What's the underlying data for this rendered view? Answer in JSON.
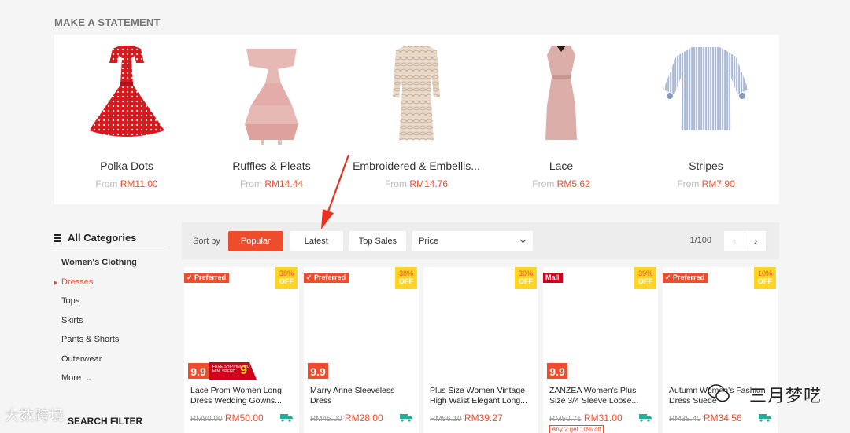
{
  "section_title": "MAKE A STATEMENT",
  "statement_categories": [
    {
      "name": "Polka Dots",
      "from_label": "From",
      "price": "RM11.00",
      "icon": "polka-dot-dress-image"
    },
    {
      "name": "Ruffles & Pleats",
      "from_label": "From",
      "price": "RM14.44",
      "icon": "ruffle-dress-image"
    },
    {
      "name": "Embroidered & Embellis...",
      "from_label": "From",
      "price": "RM14.76",
      "icon": "embroidered-dress-image"
    },
    {
      "name": "Lace",
      "from_label": "From",
      "price": "RM5.62",
      "icon": "lace-dress-image"
    },
    {
      "name": "Stripes",
      "from_label": "From",
      "price": "RM7.90",
      "icon": "striped-top-image"
    }
  ],
  "sidebar": {
    "heading": "All Categories",
    "items": [
      {
        "label": "Women's Clothing"
      },
      {
        "label": "Dresses"
      },
      {
        "label": "Tops"
      },
      {
        "label": "Skirts"
      },
      {
        "label": "Pants & Shorts"
      },
      {
        "label": "Outerwear"
      },
      {
        "label": "More"
      }
    ],
    "search_filter": "SEARCH FILTER"
  },
  "sortbar": {
    "label": "Sort by",
    "options": [
      {
        "label": "Popular"
      },
      {
        "label": "Latest"
      },
      {
        "label": "Top Sales"
      }
    ],
    "price_select": "Price",
    "page_info": "1/100"
  },
  "products": [
    {
      "tag": "Preferred",
      "discount": "38%",
      "off": "OFF",
      "badge": "9.9",
      "ship_banner": "FREE SHIPPING NO MIN. SPEND",
      "ship_num": "9",
      "name": "Lace Prom Women Long Dress Wedding Gowns...",
      "old_price": "RM80.00",
      "price": "RM50.00"
    },
    {
      "tag": "Preferred",
      "discount": "38%",
      "off": "OFF",
      "badge": "9.9",
      "name": "Marry Anne Sleeveless Dress",
      "old_price": "RM45.00",
      "price": "RM28.00"
    },
    {
      "discount": "30%",
      "off": "OFF",
      "name": "Plus Size Women Vintage High Waist Elegant Long...",
      "old_price": "RM56.10",
      "price": "RM39.27"
    },
    {
      "tag": "Mall",
      "discount": "39%",
      "off": "OFF",
      "badge": "9.9",
      "name": "ZANZEA Women's Plus Size 3/4 Sleeve Loose...",
      "old_price": "RM50.71",
      "price": "RM31.00",
      "promo": "Any 2 get 10% off"
    },
    {
      "tag": "Preferred",
      "discount": "10%",
      "off": "OFF",
      "name": "Autumn Women's Fashion Dress Suede",
      "old_price": "RM38.40",
      "price": "RM34.56"
    }
  ],
  "watermarks": {
    "left": "大数跨境",
    "right": "三月梦呓"
  },
  "colors": {
    "accent": "#ee4d2d",
    "discount_bg": "#ffd424",
    "mall": "#d0011b",
    "arrow": "#e8321e"
  }
}
